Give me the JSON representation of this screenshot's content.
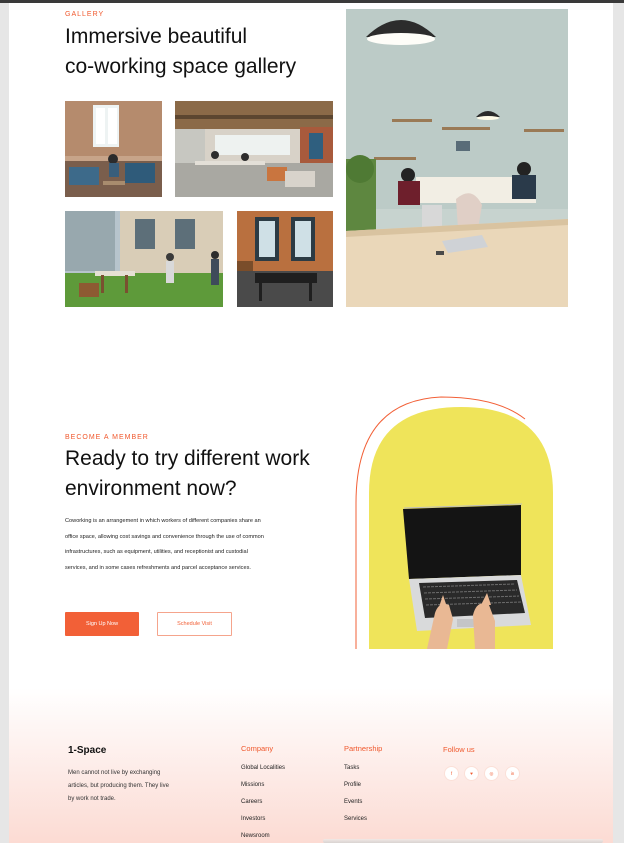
{
  "gallery": {
    "eyebrow": "GALLERY",
    "title_line1": "Immersive beautiful",
    "title_line2": "co-working space gallery"
  },
  "member": {
    "eyebrow": "BECOME A MEMBER",
    "title_line1": "Ready to try different work",
    "title_line2": "environment now?",
    "description_lines": [
      "Coworking is an arrangement in which workers of different companies share an",
      "office space, allowing cost savings and convenience through the use of common",
      "infrastructures, such as equipment, utilities, and receptionist and custodial",
      "services, and in some cases refreshments and parcel acceptance services."
    ],
    "primary_button": "Sign Up Now",
    "secondary_button": "Schedule Visit"
  },
  "footer": {
    "brand": "1-Space",
    "tagline_lines": [
      "Men cannot not live by exchanging",
      "articles, but producing them. They live",
      "by work not trade."
    ],
    "company": {
      "heading": "Company",
      "links": [
        "Global Localities",
        "Missions",
        "Careers",
        "Investors",
        "Newsroom"
      ]
    },
    "partnership": {
      "heading": "Partnership",
      "links": [
        "Tasks",
        "Profile",
        "Events",
        "Services"
      ]
    },
    "follow": {
      "heading": "Follow us",
      "icons": [
        {
          "name": "facebook-icon",
          "glyph": "f"
        },
        {
          "name": "twitter-icon",
          "glyph": "♥"
        },
        {
          "name": "dribbble-icon",
          "glyph": "◎"
        },
        {
          "name": "linkedin-icon",
          "glyph": "in"
        }
      ]
    }
  },
  "colors": {
    "accent": "#f26037",
    "title": "#111111",
    "arch_yellow": "#efe45a",
    "footer_tint": "#fdebe7"
  }
}
